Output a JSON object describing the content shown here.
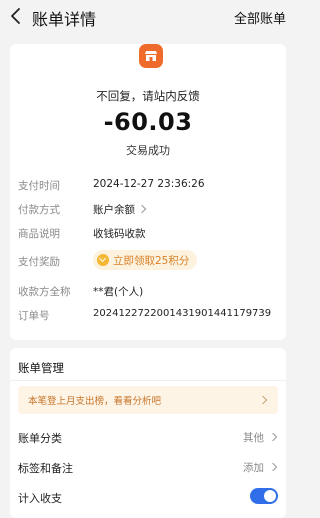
{
  "header": {
    "title": "账单详情",
    "all_bills": "全部账单"
  },
  "summary": {
    "merchant_name": "不回复，请站内反馈",
    "amount": "-60.03",
    "status": "交易成功"
  },
  "details": {
    "pay_time_label": "支付时间",
    "pay_time_value": "2024-12-27 23:36:26",
    "pay_method_label": "付款方式",
    "pay_method_value": "账户余额",
    "product_label": "商品说明",
    "product_value": "收钱码收款",
    "reward_label": "支付奖励",
    "reward_value": "立即领取25积分",
    "payee_label": "收款方全称",
    "payee_value": "**君(个人)",
    "order_label": "订单号",
    "order_value": "2024122722001431901441179739"
  },
  "management": {
    "title": "账单管理",
    "banner_text": "本笔登上月支出榜，看看分析吧",
    "category_label": "账单分类",
    "category_value": "其他",
    "tags_label": "标签和备注",
    "tags_value": "添加",
    "budget_label": "计入收支",
    "budget_enabled": true
  },
  "colors": {
    "accent": "#2f6ee8",
    "merchant_logo": "#ef6b2c",
    "reward": "#d8812a"
  }
}
